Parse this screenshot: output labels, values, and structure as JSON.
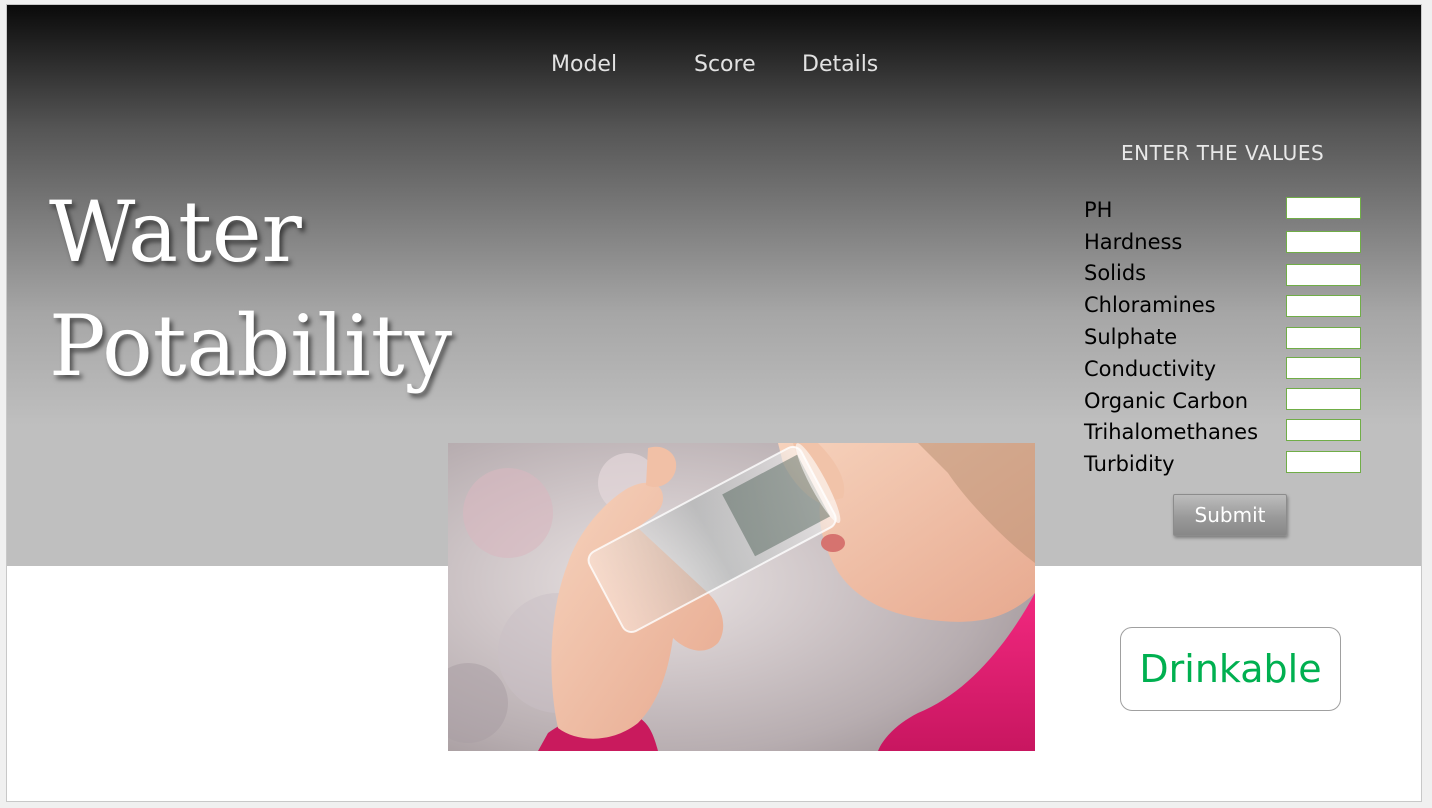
{
  "nav": {
    "items": [
      {
        "label": "Model"
      },
      {
        "label": "Score"
      },
      {
        "label": "Details"
      }
    ]
  },
  "hero": {
    "title_line1": "Water",
    "title_line2": "Potability"
  },
  "form": {
    "heading": "ENTER THE VALUES",
    "fields": [
      {
        "label": "PH",
        "value": ""
      },
      {
        "label": "Hardness",
        "value": ""
      },
      {
        "label": "Solids",
        "value": ""
      },
      {
        "label": "Chloramines",
        "value": ""
      },
      {
        "label": "Sulphate",
        "value": ""
      },
      {
        "label": "Conductivity",
        "value": ""
      },
      {
        "label": "Organic Carbon",
        "value": ""
      },
      {
        "label": "Trihalomethanes",
        "value": ""
      },
      {
        "label": "Turbidity",
        "value": ""
      }
    ],
    "submit_label": "Submit"
  },
  "result": {
    "text": "Drinkable",
    "color": "#00b050"
  },
  "colors": {
    "input_border": "#70ad47",
    "hero_bottom": "#bfbfbf"
  }
}
